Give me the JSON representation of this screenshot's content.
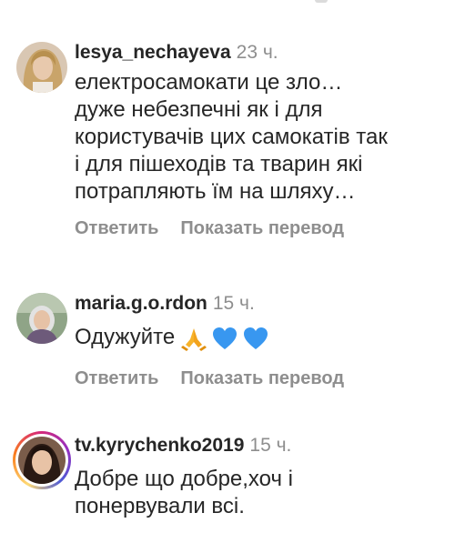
{
  "comments": [
    {
      "username": "lesya_nechayeva",
      "time": "23 ч.",
      "text_lines": [
        "електросамокати це зло…",
        "дуже небезпечні як і для",
        "користувачів цих самокатів так",
        "і для пішеходів та тварин які",
        "потрапляють їм на шляху…"
      ],
      "reply_label": "Ответить",
      "translate_label": "Показать перевод"
    },
    {
      "username": "maria.g.o.rdon",
      "time": "15 ч.",
      "text": "Одужуйте",
      "emoji": [
        "praying-hands",
        "blue-heart",
        "blue-heart"
      ],
      "reply_label": "Ответить",
      "translate_label": "Показать перевод"
    },
    {
      "username": "tv.kyrychenko2019",
      "time": "15 ч.",
      "text_lines": [
        "Добре що добре,хоч і",
        "понервували всі."
      ]
    }
  ],
  "colors": {
    "text": "#262626",
    "secondary": "#8e8e8e",
    "blue_heart": "#3897f0",
    "praying_hands": "#f7b32b"
  }
}
